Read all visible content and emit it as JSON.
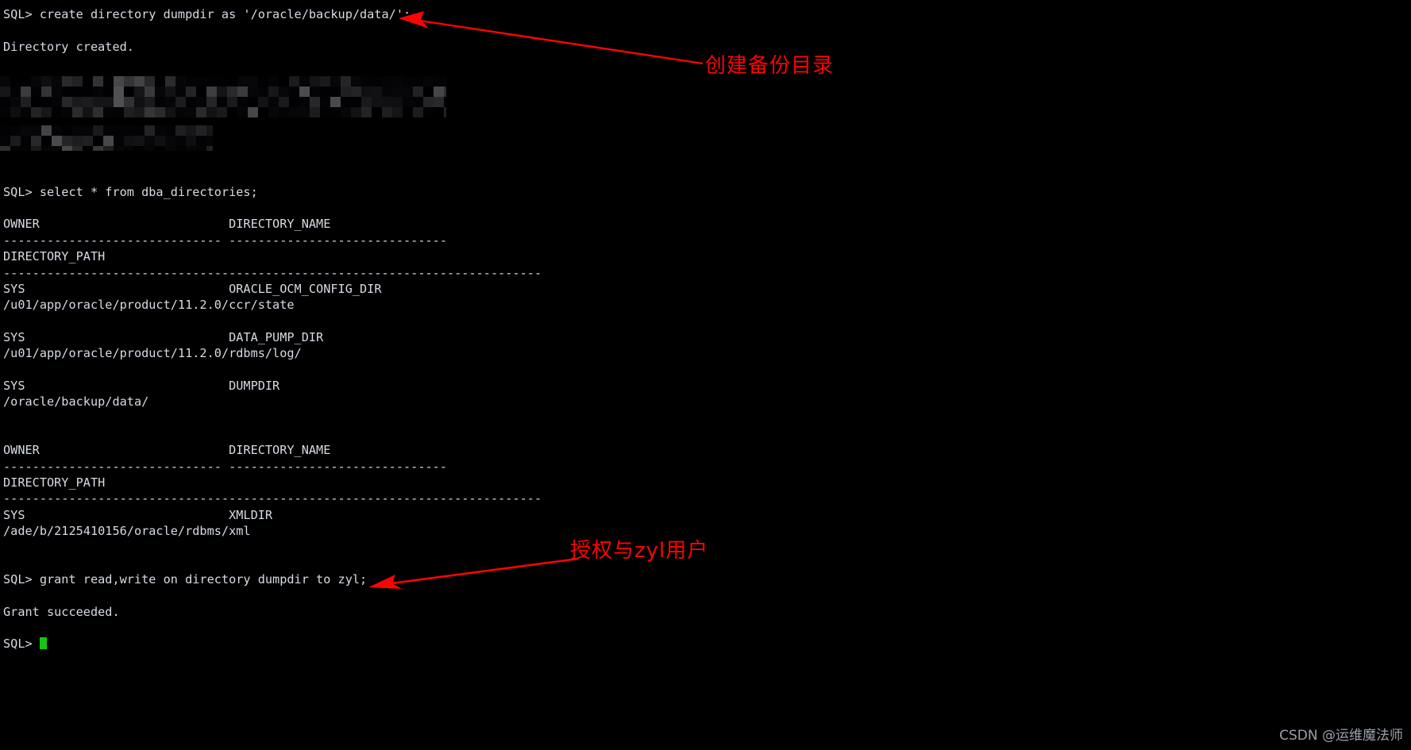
{
  "terminal": {
    "prompt": "SQL>",
    "background_color": "#000000",
    "text_color": "#d6dbe4",
    "cursor_color": "#16c60c",
    "lines": [
      "SQL> create directory dumpdir as '/oracle/backup/data/';",
      "",
      "Directory created.",
      "",
      "[REDACTED]",
      "[REDACTED]",
      "",
      "[REDACTED]",
      "[REDACTED]",
      "",
      "",
      "SQL> select * from dba_directories;",
      "",
      "OWNER                          DIRECTORY_NAME",
      "------------------------------ ------------------------------",
      "DIRECTORY_PATH",
      "--------------------------------------------------------------------------",
      "SYS                            ORACLE_OCM_CONFIG_DIR",
      "/u01/app/oracle/product/11.2.0/ccr/state",
      "",
      "SYS                            DATA_PUMP_DIR",
      "/u01/app/oracle/product/11.2.0/rdbms/log/",
      "",
      "SYS                            DUMPDIR",
      "/oracle/backup/data/",
      "",
      "",
      "OWNER                          DIRECTORY_NAME",
      "------------------------------ ------------------------------",
      "DIRECTORY_PATH",
      "--------------------------------------------------------------------------",
      "SYS                            XMLDIR",
      "/ade/b/2125410156/oracle/rdbms/xml",
      "",
      "",
      "SQL> grant read,write on directory dumpdir to zyl;",
      "",
      "Grant succeeded.",
      "",
      "SQL> "
    ],
    "commands": [
      {
        "text": "create directory dumpdir as '/oracle/backup/data/';",
        "result": "Directory created."
      },
      {
        "text": "select * from dba_directories;",
        "result": ""
      },
      {
        "text": "grant read,write on directory dumpdir to zyl;",
        "result": "Grant succeeded."
      }
    ],
    "query_results": {
      "columns": [
        "OWNER",
        "DIRECTORY_NAME",
        "DIRECTORY_PATH"
      ],
      "rows": [
        {
          "owner": "SYS",
          "directory_name": "ORACLE_OCM_CONFIG_DIR",
          "directory_path": "/u01/app/oracle/product/11.2.0/ccr/state"
        },
        {
          "owner": "SYS",
          "directory_name": "DATA_PUMP_DIR",
          "directory_path": "/u01/app/oracle/product/11.2.0/rdbms/log/"
        },
        {
          "owner": "SYS",
          "directory_name": "DUMPDIR",
          "directory_path": "/oracle/backup/data/"
        },
        {
          "owner": "SYS",
          "directory_name": "XMLDIR",
          "directory_path": "/ade/b/2125410156/oracle/rdbms/xml"
        }
      ]
    }
  },
  "annotations": {
    "color": "#fb0404",
    "items": [
      {
        "label": "创建备份目录",
        "note_name": "create-backup-dir-note"
      },
      {
        "label": "授权与zyl用户",
        "note_name": "grant-privilege-note"
      }
    ]
  },
  "watermark": {
    "text": "CSDN @运维魔法师"
  }
}
